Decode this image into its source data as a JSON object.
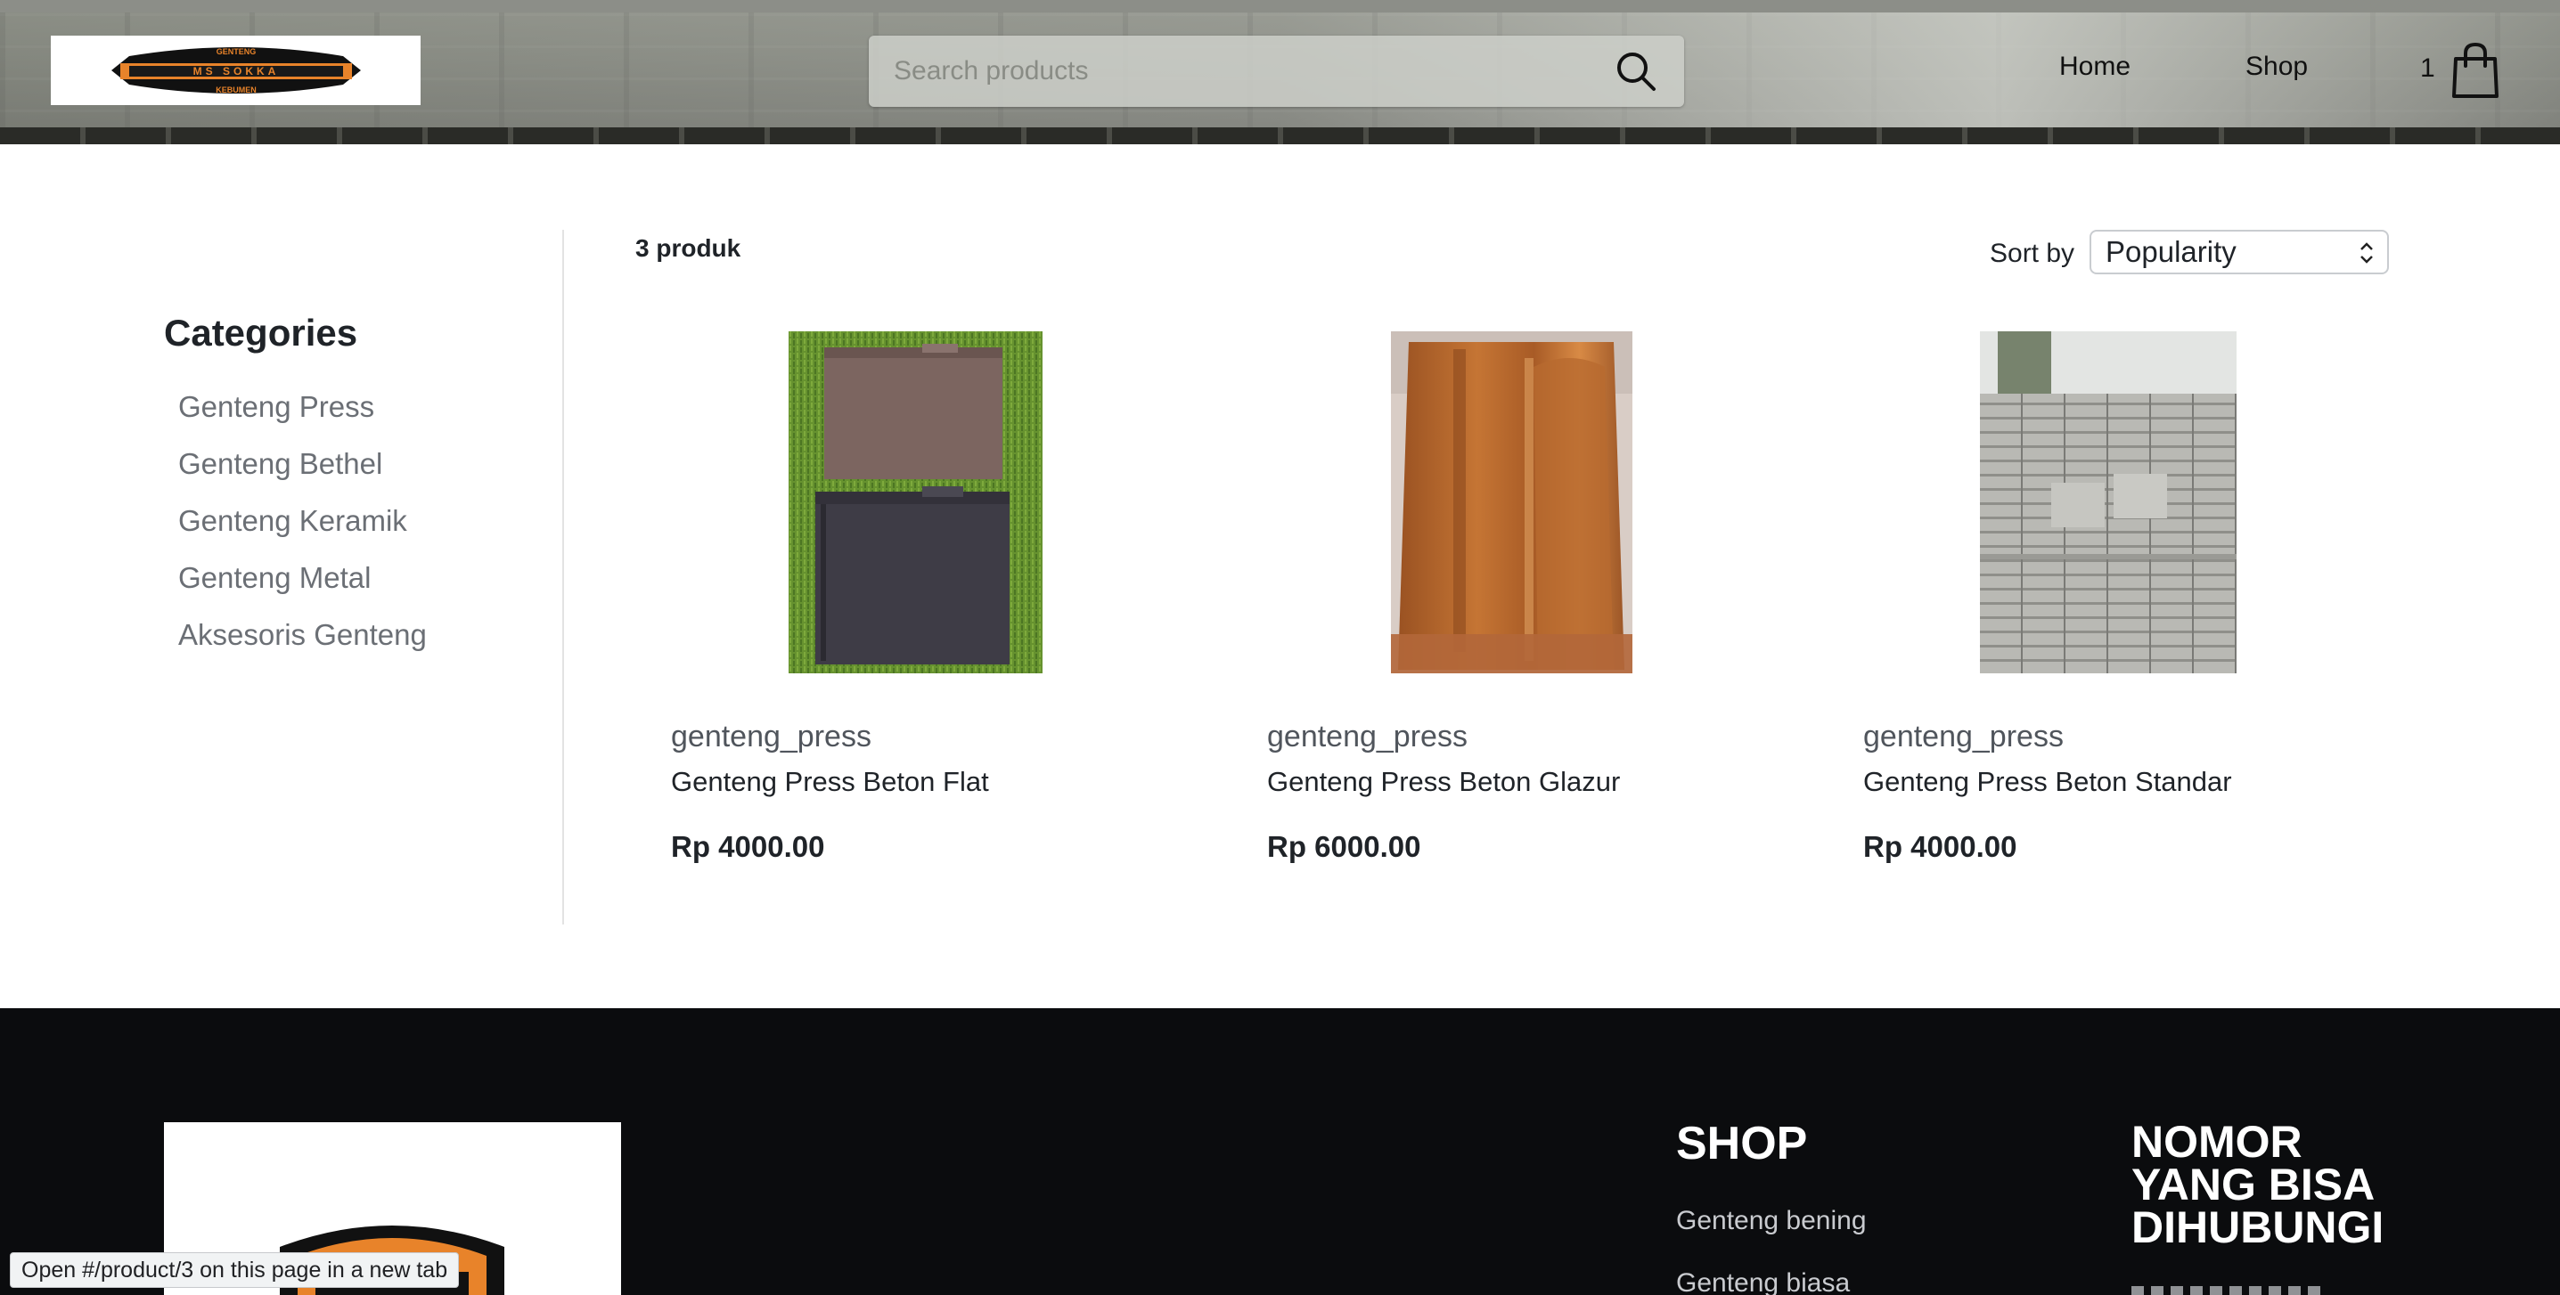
{
  "header": {
    "logo_text_top": "GENTENG",
    "logo_text_main": "MS SOKKA",
    "logo_text_bottom": "KEBUMEN",
    "search": {
      "placeholder": "Search products",
      "value": ""
    },
    "nav": [
      {
        "label": "Home"
      },
      {
        "label": "Shop"
      }
    ],
    "cart_count": "1"
  },
  "sidebar": {
    "title": "Categories",
    "items": [
      {
        "label": "Genteng Press"
      },
      {
        "label": "Genteng Bethel"
      },
      {
        "label": "Genteng Keramik"
      },
      {
        "label": "Genteng Metal"
      },
      {
        "label": "Aksesoris Genteng"
      }
    ]
  },
  "main": {
    "product_count": "3 produk",
    "sort": {
      "label": "Sort by",
      "selected": "Popularity"
    },
    "products": [
      {
        "category": "genteng_press",
        "name": "Genteng Press Beton Flat",
        "price": "Rp 4000.00",
        "image": "two stacked flat roof tiles, brown and black, on grass"
      },
      {
        "category": "genteng_press",
        "name": "Genteng Press Beton Glazur",
        "price": "Rp 6000.00",
        "image": "glossy orange glazed roof tile"
      },
      {
        "category": "genteng_press",
        "name": "Genteng Press Beton Standar",
        "price": "Rp 4000.00",
        "image": "stacks of grey concrete roof tiles"
      }
    ]
  },
  "footer": {
    "shop_title": "SHOP",
    "shop_links": [
      {
        "label": "Genteng bening"
      },
      {
        "label": "Genteng biasa"
      }
    ],
    "contact_title": "NOMOR YANG BISA DIHUBUNGI"
  },
  "status_bar": {
    "text": "Open #/product/3 on this page in a new tab"
  },
  "colors": {
    "accent_orange": "#e8832a",
    "footer_bg": "#0b0c0e",
    "text_dark": "#1f2328",
    "category_gray": "#6b6f75"
  }
}
